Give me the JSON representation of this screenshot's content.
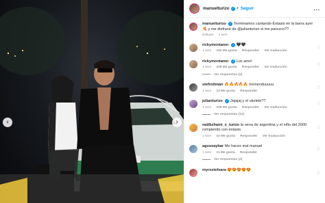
{
  "post": {
    "username": "manuelturizo",
    "follow_label": "Seguir",
    "more_label": "...",
    "separator": "•",
    "verified_mark": "✓"
  },
  "caption": {
    "username": "manuelturizo",
    "text": "Terminamos cantando Éxtasis en la barra ayer 🍕 y me disfracé de @julianturizo si me parezco??",
    "edited": "Editado",
    "time": "1 sem"
  },
  "comments": [
    {
      "username": "rickymontaner",
      "text": "🖤🖤",
      "time": "1 sem",
      "likes": "162 Me gusta",
      "reply": "Responder",
      "translate": "Ver traducción",
      "replies": ""
    },
    {
      "username": "rickymontaner",
      "text": "Los amo!",
      "time": "1 sem",
      "likes": "239 Me gusta",
      "reply": "Responder",
      "translate": "Ver traducción",
      "replies": "Ver respuestas (2)"
    },
    {
      "username": "stefroitman",
      "text": "🔥🔥🔥🔥🔥 tremenduuuuu",
      "time": "1 sem",
      "likes": "13 Me gusta",
      "reply": "Responder",
      "translate": "",
      "replies": ""
    },
    {
      "username": "julianturizo",
      "text": "Jajajaj y el ukelele??",
      "time": "1 sem",
      "likes": "229 Me gusta",
      "reply": "Responder",
      "translate": "Ver traducción",
      "replies": "Ver respuestas (12)"
    },
    {
      "username": "nattbzhami_x_turizo",
      "text": "la nena de argentina y el niño del 2000 rompiendo con éxtasis.",
      "time": "1 sem",
      "likes": "10 Me gusta",
      "reply": "Responder",
      "translate": "Ver traducción",
      "replies": ""
    },
    {
      "username": "agussaybar",
      "text": "Me haces mal manuel",
      "time": "1 sem",
      "likes": "11 Me gusta",
      "reply": "Responder",
      "translate": "",
      "replies": "Ver respuestas (2)"
    },
    {
      "username": "myrxstefsara",
      "text": "😍😍😍😍😍",
      "time": "",
      "likes": "",
      "reply": "",
      "translate": "",
      "replies": ""
    }
  ],
  "icons": {
    "heart": "♡",
    "prev": "‹",
    "next": "›"
  }
}
